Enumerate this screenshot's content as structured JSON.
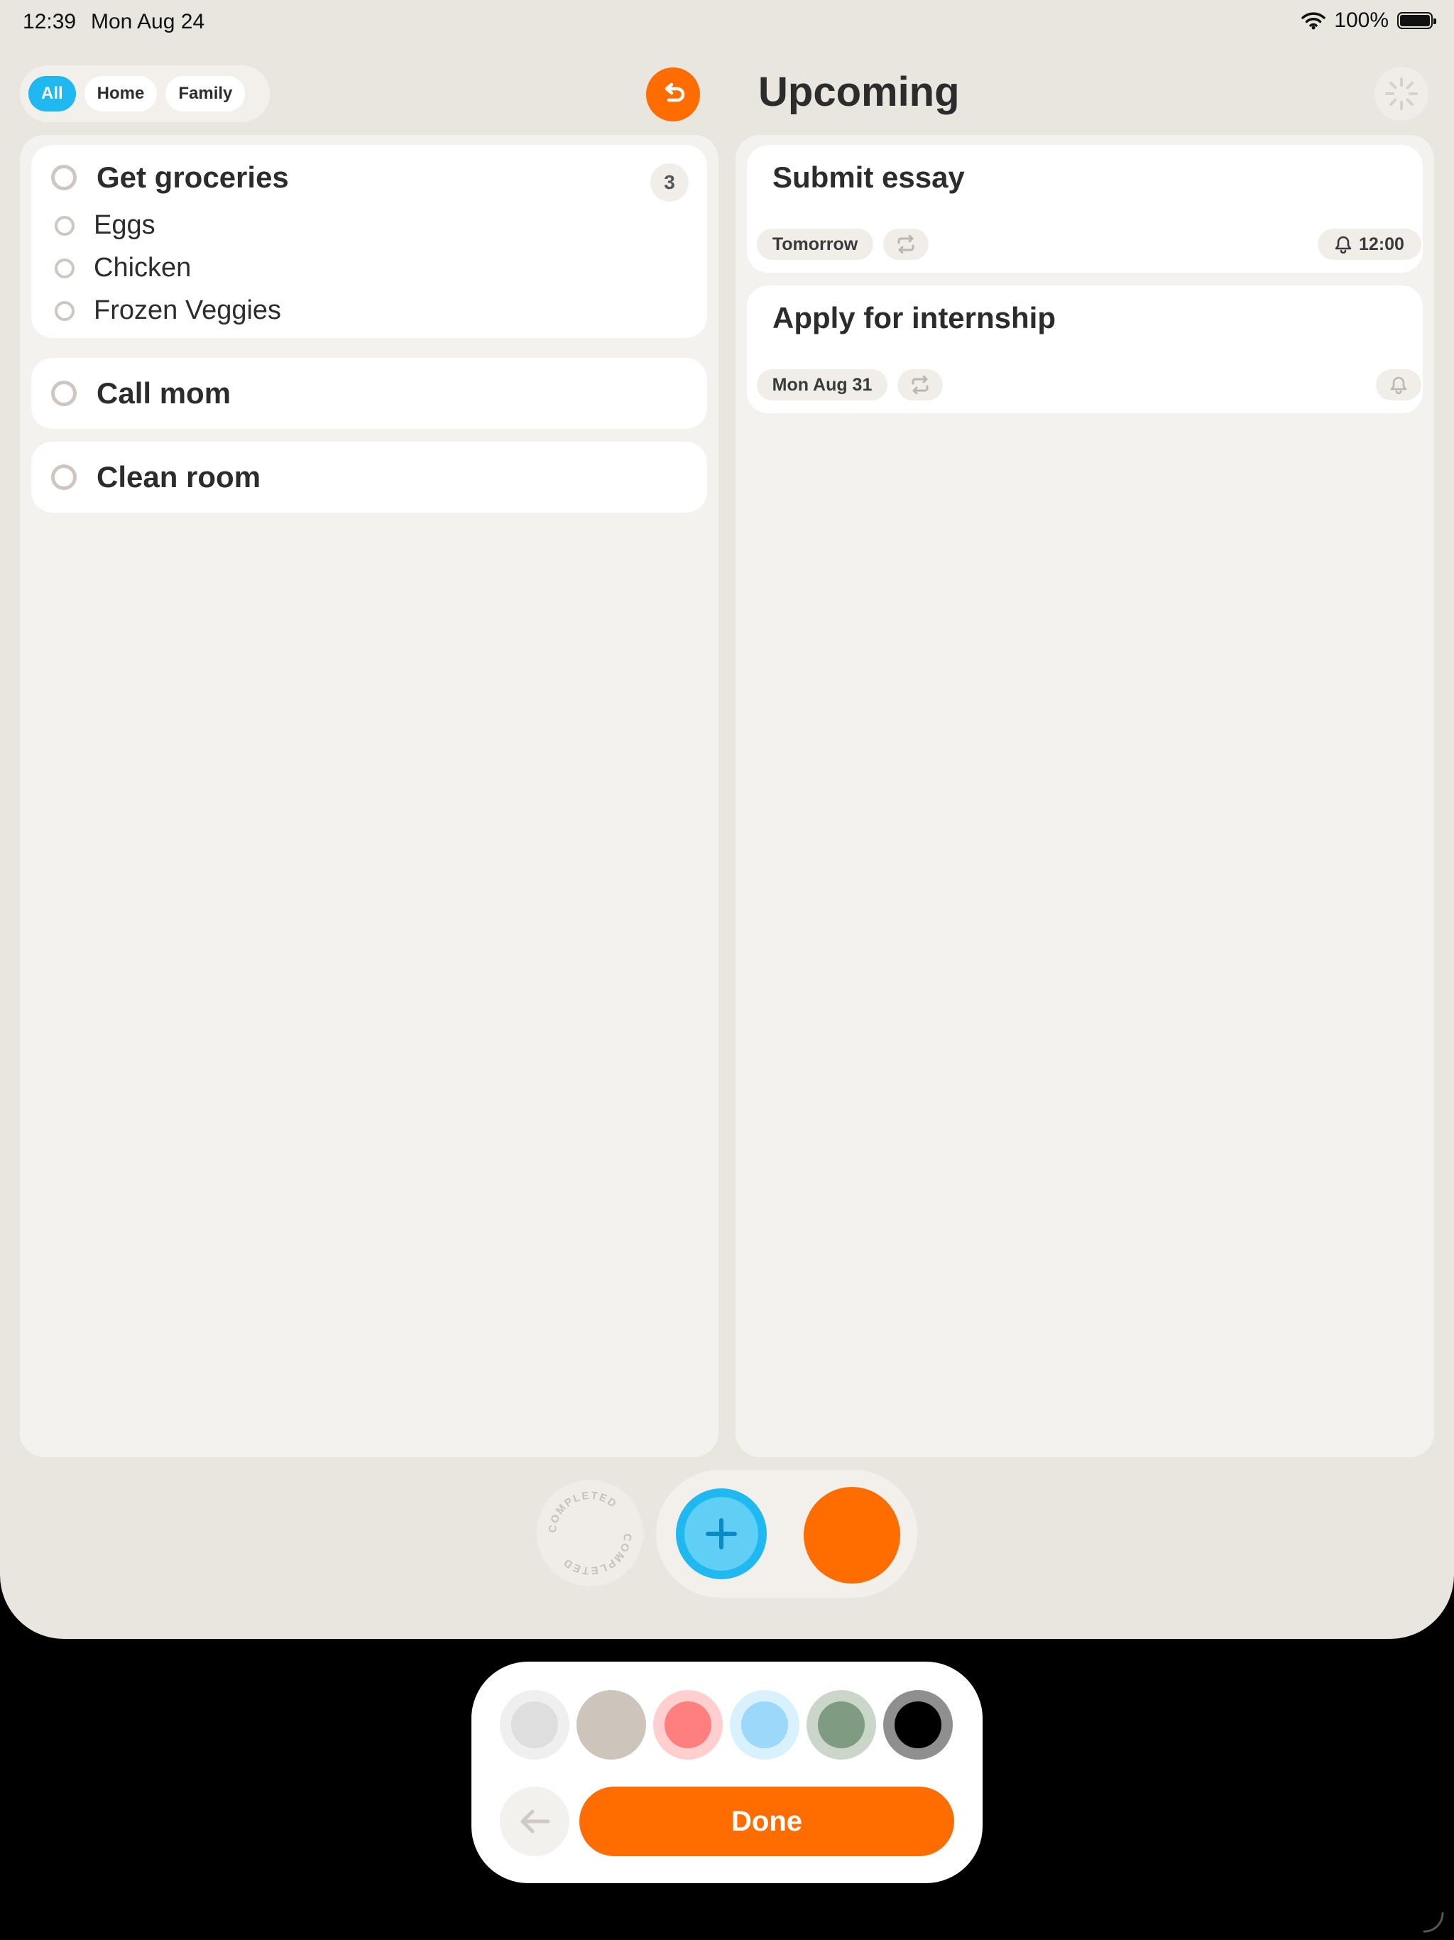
{
  "status_bar": {
    "time": "12:39",
    "date": "Mon Aug 24",
    "battery": "100%"
  },
  "filters": [
    {
      "label": "All",
      "active": true
    },
    {
      "label": "Home",
      "active": false
    },
    {
      "label": "Family",
      "active": false
    }
  ],
  "upcoming": {
    "title": "Upcoming",
    "tasks": [
      {
        "title": "Submit essay",
        "due": "Tomorrow",
        "reminder": "12:00"
      },
      {
        "title": "Apply for internship",
        "due": "Mon Aug 31",
        "reminder": ""
      }
    ]
  },
  "tasks": [
    {
      "title": "Get groceries",
      "count": "3",
      "subtasks": [
        "Eggs",
        "Chicken",
        "Frozen Veggies"
      ]
    },
    {
      "title": "Call mom"
    },
    {
      "title": "Clean room"
    }
  ],
  "completed_stamp_text": "COMPLETED",
  "color_picker": {
    "swatches": [
      {
        "name": "light-gray",
        "outer": "#efefef",
        "inner": "#dedede"
      },
      {
        "name": "beige",
        "outer": "#cdc5bb",
        "inner": "#cdc5bb"
      },
      {
        "name": "red",
        "outer": "#ffcfcf",
        "inner": "#ff7f7f"
      },
      {
        "name": "blue",
        "outer": "#d9f1fd",
        "inner": "#9bd8fa"
      },
      {
        "name": "green",
        "outer": "#c9d6c9",
        "inner": "#7f9b81"
      },
      {
        "name": "black",
        "outer": "#8f8f8f",
        "inner": "#000000"
      }
    ],
    "done_label": "Done"
  },
  "colors": {
    "accent": "#ff6d00",
    "primary": "#1fb8f0"
  }
}
